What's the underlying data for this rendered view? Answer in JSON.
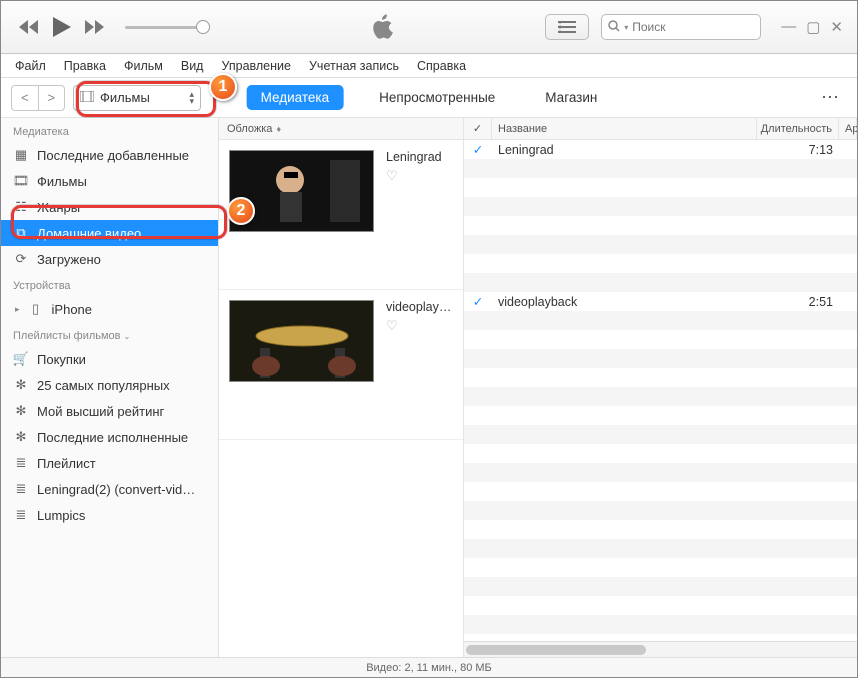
{
  "search": {
    "placeholder": "Поиск"
  },
  "menubar": [
    "Файл",
    "Правка",
    "Фильм",
    "Вид",
    "Управление",
    "Учетная запись",
    "Справка"
  ],
  "category_dd": {
    "label": "Фильмы"
  },
  "tabs": [
    {
      "label": "Медиатека",
      "active": true
    },
    {
      "label": "Непросмотренные",
      "active": false
    },
    {
      "label": "Магазин",
      "active": false
    }
  ],
  "sidebar": {
    "sections": [
      {
        "title": "Медиатека",
        "items": [
          {
            "icon": "grid",
            "label": "Последние добавленные"
          },
          {
            "icon": "film",
            "label": "Фильмы"
          },
          {
            "icon": "genres",
            "label": "Жанры"
          },
          {
            "icon": "home-video",
            "label": "Домашние видео",
            "selected": true
          },
          {
            "icon": "download",
            "label": "Загружено"
          }
        ]
      },
      {
        "title": "Устройства",
        "items": [
          {
            "icon": "phone",
            "label": "iPhone",
            "disclosure": true
          }
        ]
      },
      {
        "title": "Плейлисты фильмов",
        "chevron": true,
        "items": [
          {
            "icon": "cart",
            "label": "Покупки"
          },
          {
            "icon": "gear",
            "label": "25 самых популярных"
          },
          {
            "icon": "gear",
            "label": "Мой высший рейтинг"
          },
          {
            "icon": "gear",
            "label": "Последние исполненные"
          },
          {
            "icon": "playlist",
            "label": "Плейлист"
          },
          {
            "icon": "playlist",
            "label": "Leningrad(2) (convert-vid…"
          },
          {
            "icon": "playlist",
            "label": "Lumpics"
          }
        ]
      }
    ]
  },
  "album_header": "Обложка",
  "track_headers": {
    "name": "Название",
    "duration": "Длительность",
    "extra": "Ар"
  },
  "videos": [
    {
      "title": "Leningrad",
      "track": "Leningrad",
      "duration": "7:13",
      "checked": true
    },
    {
      "title": "videoplay…",
      "track": "videoplayback",
      "duration": "2:51",
      "checked": true
    }
  ],
  "statusbar": "Видео: 2, 11 мин., 80 МБ",
  "callouts": {
    "one": "1",
    "two": "2"
  }
}
